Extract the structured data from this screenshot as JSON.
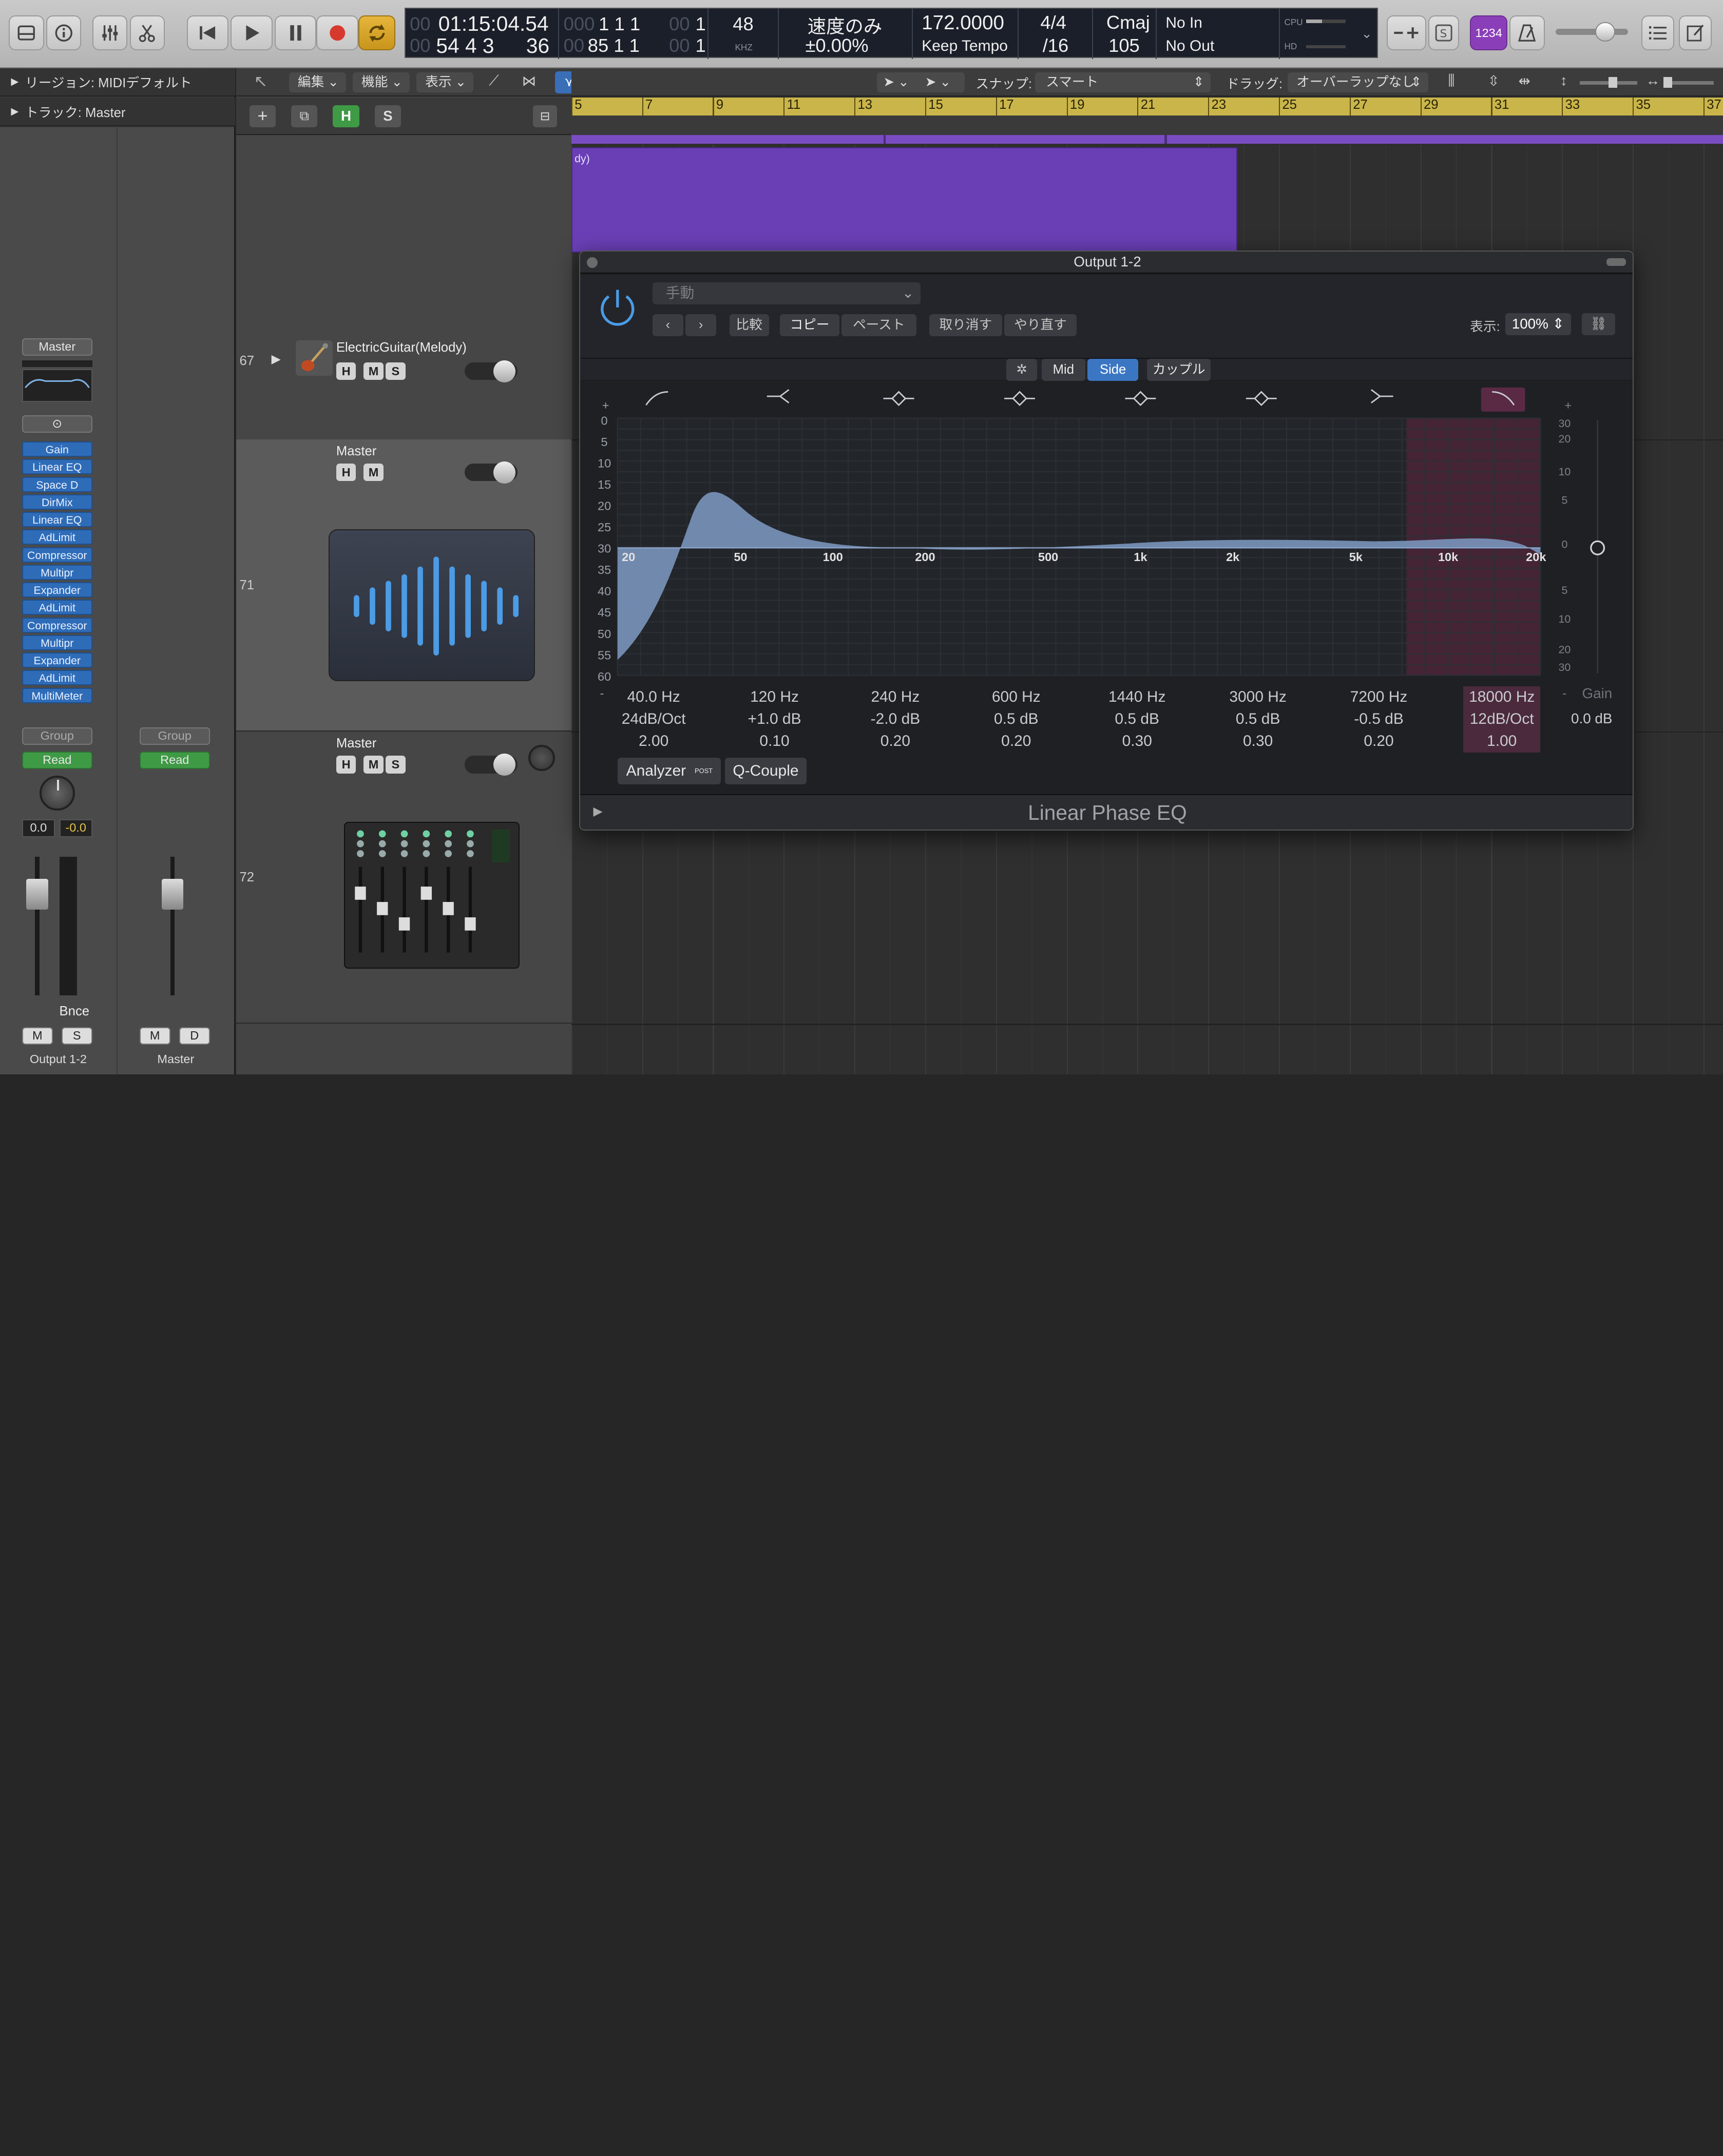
{
  "control_bar": {
    "time": "01:15:04.54",
    "time_prefix": "00",
    "bars": "54  4  3",
    "bars_sub": "36",
    "bars_prefix": "00",
    "pos_top": "1   1   1",
    "pos_top_sub": "1",
    "pos_top_prefix": "000",
    "pos_bottom": "85   1   1",
    "pos_bottom_sub": "1",
    "pos_bottom_prefix": "00",
    "sub_prefix": "00",
    "sample_rate": "48",
    "sample_unit": "KHZ",
    "varispeed_mode": "速度のみ",
    "varispeed_value": "±0.00%",
    "tempo": "172.0000",
    "tempo_mode": "Keep Tempo",
    "time_sig": "4/4",
    "division": "/16",
    "key": "Cmaj",
    "key_num": "105",
    "input": "No In",
    "output": "No Out",
    "cpu_label": "CPU",
    "hd_label": "HD",
    "count_in": "1234"
  },
  "inspector": {
    "region_label": "リージョン: MIDIデフォルト",
    "track_label": "トラック: Master",
    "master_label": "Master",
    "plugins": [
      "Gain",
      "Linear EQ",
      "Space D",
      "DirMix",
      "Linear EQ",
      "AdLimit",
      "Compressor",
      "Multipr",
      "Expander",
      "AdLimit",
      "Compressor",
      "Multipr",
      "Expander",
      "AdLimit",
      "MultiMeter"
    ],
    "group": "Group",
    "read": "Read",
    "vol1": "0.0",
    "vol2": "-0.0",
    "bnce": "Bnce",
    "m": "M",
    "s": "S",
    "d": "D",
    "strip1_name": "Output 1-2",
    "strip2_name": "Master"
  },
  "tracks_toolbar": {
    "edit": "編集",
    "function": "機能",
    "view": "表示",
    "snap_label": "スナップ:",
    "snap_value": "スマート",
    "drag_label": "ドラッグ:",
    "drag_value": "オーバーラップなし",
    "h": "H",
    "s": "S"
  },
  "ruler": [
    "5",
    "7",
    "9",
    "11",
    "13",
    "15",
    "17",
    "19",
    "21",
    "23",
    "25",
    "27",
    "29",
    "31",
    "33",
    "35",
    "37"
  ],
  "tracks": [
    {
      "num": "67",
      "name": "ElectricGuitar(Melody)"
    },
    {
      "num": "71",
      "name": "Master"
    },
    {
      "num": "72",
      "name": "Master"
    }
  ],
  "region_label": "dy)",
  "plugin": {
    "title": "Output 1-2",
    "preset": "手動",
    "compare": "比較",
    "copy": "コピー",
    "paste": "ペースト",
    "undo": "取り消す",
    "redo": "やり直す",
    "view_label": "表示:",
    "zoom": "100%",
    "mid": "Mid",
    "side": "Side",
    "couple": "カップル",
    "db_left": [
      "0",
      "5",
      "10",
      "15",
      "20",
      "25",
      "30",
      "35",
      "40",
      "45",
      "50",
      "55",
      "60"
    ],
    "db_right": [
      "30",
      "20",
      "10",
      "5",
      "0",
      "5",
      "10",
      "20",
      "30"
    ],
    "freq_labels": [
      "20",
      "50",
      "100",
      "200",
      "500",
      "1k",
      "2k",
      "5k",
      "10k",
      "20k"
    ],
    "bands": [
      {
        "freq": "40.0 Hz",
        "gain": "24dB/Oct",
        "q": "2.00"
      },
      {
        "freq": "120 Hz",
        "gain": "+1.0 dB",
        "q": "0.10"
      },
      {
        "freq": "240 Hz",
        "gain": "-2.0 dB",
        "q": "0.20"
      },
      {
        "freq": "600 Hz",
        "gain": "0.5 dB",
        "q": "0.20"
      },
      {
        "freq": "1440 Hz",
        "gain": "0.5 dB",
        "q": "0.30"
      },
      {
        "freq": "3000 Hz",
        "gain": "0.5 dB",
        "q": "0.30"
      },
      {
        "freq": "7200 Hz",
        "gain": "-0.5 dB",
        "q": "0.20"
      },
      {
        "freq": "18000 Hz",
        "gain": "12dB/Oct",
        "q": "1.00"
      }
    ],
    "gain_label": "Gain",
    "gain_value": "0.0 dB",
    "analyzer": "Analyzer",
    "analyzer_badge": "POST",
    "qcouple": "Q-Couple",
    "plugin_name": "Linear Phase EQ"
  }
}
